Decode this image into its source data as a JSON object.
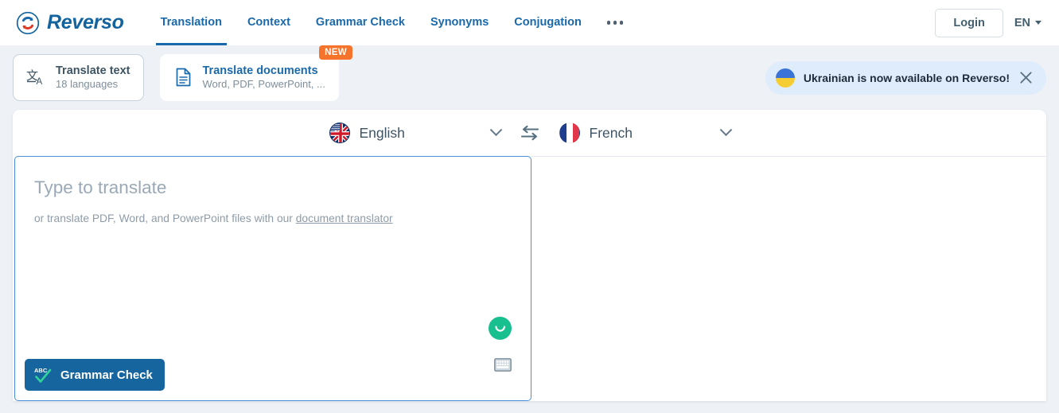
{
  "brand": {
    "name": "Reverso",
    "logo_icon": "reverso-cycle-logo",
    "accent": "#13639e"
  },
  "header": {
    "nav": [
      {
        "label": "Translation",
        "active": true
      },
      {
        "label": "Context",
        "active": false
      },
      {
        "label": "Grammar Check",
        "active": false
      },
      {
        "label": "Synonyms",
        "active": false
      },
      {
        "label": "Conjugation",
        "active": false
      }
    ],
    "more_icon": "ellipsis-icon",
    "login_label": "Login",
    "interface_language": "EN",
    "caret_icon": "chevron-down-icon"
  },
  "toolbar": {
    "translate_text": {
      "icon": "translate-icon",
      "title": "Translate text",
      "subtitle": "18 languages"
    },
    "translate_documents": {
      "icon": "document-icon",
      "title": "Translate documents",
      "subtitle": "Word, PDF, PowerPoint, ...",
      "badge": "NEW",
      "badge_color": "#f5732a"
    },
    "notice": {
      "flag_icon": "ukraine-flag-icon",
      "text": "Ukrainian is now available on Reverso!",
      "close_icon": "close-icon",
      "background": "#dfecfb"
    }
  },
  "translator": {
    "source": {
      "language": "English",
      "flag_icon": "english-flag-icon",
      "caret_icon": "chevron-down-icon"
    },
    "swap_icon": "swap-languages-icon",
    "target": {
      "language": "French",
      "flag_icon": "french-flag-icon",
      "caret_icon": "chevron-down-icon"
    },
    "input": {
      "placeholder": "Type to translate",
      "hint_prefix": "or translate PDF, Word, and PowerPoint files with our ",
      "hint_link": "document translator",
      "value": ""
    },
    "output": {
      "value": ""
    },
    "controls": {
      "mic_icon": "microphone-icon",
      "mic_color": "#18bf8f",
      "keyboard_icon": "keyboard-icon",
      "grammar_check_label": "Grammar Check",
      "grammar_check_icon": "abc-check-icon",
      "grammar_check_color": "#16659f"
    }
  }
}
